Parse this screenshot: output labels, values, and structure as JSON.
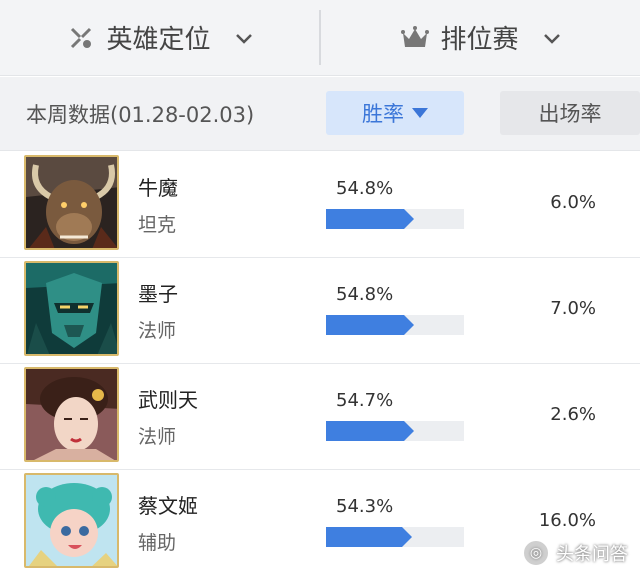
{
  "filters": [
    {
      "label": "英雄定位",
      "icon": "role-icon"
    },
    {
      "label": "排位赛",
      "icon": "crown-icon"
    }
  ],
  "subheader": {
    "week_label": "本周数据(01.28-02.03)",
    "sort_win": "胜率",
    "sort_pick": "出场率"
  },
  "heroes": [
    {
      "name": "牛魔",
      "role": "坦克",
      "win_rate": "54.8%",
      "win_value": 54.8,
      "pick_rate": "6.0%"
    },
    {
      "name": "墨子",
      "role": "法师",
      "win_rate": "54.8%",
      "win_value": 54.8,
      "pick_rate": "7.0%"
    },
    {
      "name": "武则天",
      "role": "法师",
      "win_rate": "54.7%",
      "win_value": 54.7,
      "pick_rate": "2.6%"
    },
    {
      "name": "蔡文姬",
      "role": "辅助",
      "win_rate": "54.3%",
      "win_value": 54.3,
      "pick_rate": "16.0%"
    }
  ],
  "watermark": "头条问答",
  "colors": {
    "accent": "#3b76d8",
    "bar": "#3f7fe0",
    "avatar_border": "#d8b96b"
  }
}
